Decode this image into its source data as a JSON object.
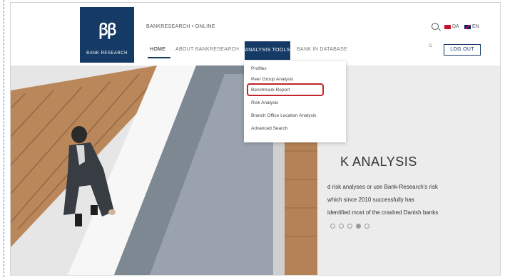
{
  "header": {
    "logo_glyph": "ꞵꞵ",
    "logo_name": "BANK RESEARCH",
    "site_title": "BANKRESEARCH • ONLINE",
    "nav": [
      {
        "label": "HOME"
      },
      {
        "label": "ABOUT BANKRESEARCH"
      },
      {
        "label": "ANALYSIS TOOLS"
      },
      {
        "label": "BANK IN DATABASE"
      }
    ],
    "lang_da": "DA",
    "lang_en": "EN",
    "user_glyph": "ᴼ̴",
    "logout_label": "LOG OUT"
  },
  "dropdown": {
    "items": [
      {
        "label": "Profiles"
      },
      {
        "label": "Peer Group Analysis"
      },
      {
        "label": "Benchmark Report"
      },
      {
        "label": "Risk Analysis"
      },
      {
        "label": "Branch Office Location Analysis"
      },
      {
        "label": "Advanced Search"
      }
    ]
  },
  "hero": {
    "title": "K ANALYSIS",
    "line1": "d risk analyses or use Bank-Research's risk",
    "line2": "which since 2010 successfully has",
    "line3": "identified most of the crashed Danish banks",
    "slide_count": 5,
    "active_slide": 4
  },
  "colors": {
    "brand": "#163a66",
    "highlight": "#c0252b"
  }
}
